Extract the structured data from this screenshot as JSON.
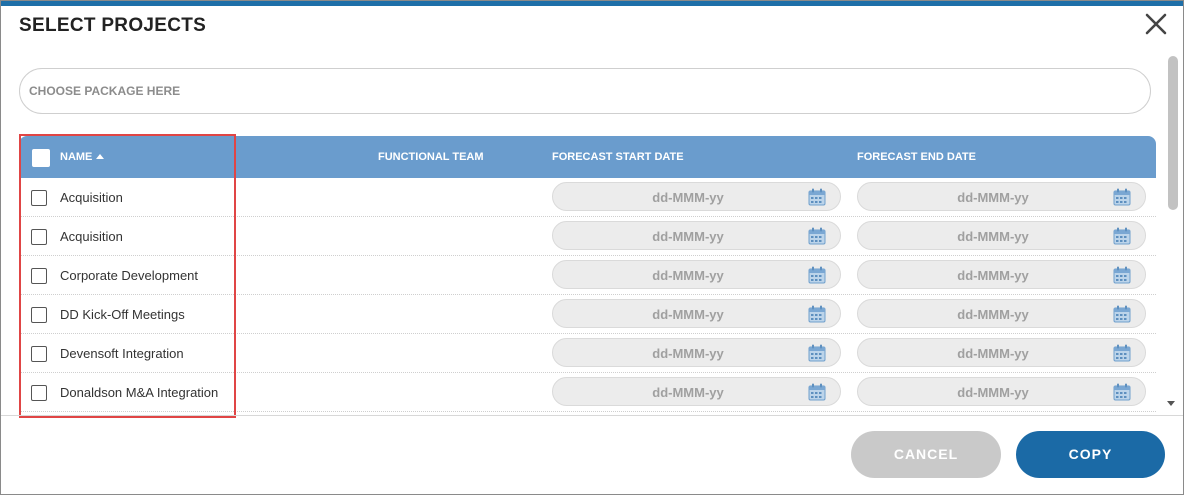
{
  "dialog": {
    "title": "SELECT PROJECTS",
    "close_icon": "close-icon"
  },
  "package": {
    "placeholder": "CHOOSE PACKAGE HERE"
  },
  "table": {
    "headers": {
      "name": "NAME",
      "functional_team": "FUNCTIONAL TEAM",
      "forecast_start_date": "FORECAST START DATE",
      "forecast_end_date": "FORECAST END DATE"
    },
    "sort_icon": "sort-ascending-icon",
    "date_placeholder": "dd-MMM-yy",
    "calendar_icon": "calendar-icon",
    "rows": [
      {
        "name": "Acquisition",
        "functional_team": "",
        "start": "dd-MMM-yy",
        "end": "dd-MMM-yy"
      },
      {
        "name": "Acquisition",
        "functional_team": "",
        "start": "dd-MMM-yy",
        "end": "dd-MMM-yy"
      },
      {
        "name": "Corporate Development",
        "functional_team": "",
        "start": "dd-MMM-yy",
        "end": "dd-MMM-yy"
      },
      {
        "name": "DD Kick-Off Meetings",
        "functional_team": "",
        "start": "dd-MMM-yy",
        "end": "dd-MMM-yy"
      },
      {
        "name": "Devensoft Integration",
        "functional_team": "",
        "start": "dd-MMM-yy",
        "end": "dd-MMM-yy"
      },
      {
        "name": "Donaldson M&A Integration",
        "functional_team": "",
        "start": "dd-MMM-yy",
        "end": "dd-MMM-yy"
      }
    ]
  },
  "footer": {
    "cancel_label": "CANCEL",
    "copy_label": "COPY"
  },
  "colors": {
    "header_bg": "#6a9ccd",
    "primary_button": "#1b6aa6",
    "disabled_button": "#c9c9c9",
    "highlight": "#e04545",
    "accent_bar": "#1e6fa8"
  }
}
